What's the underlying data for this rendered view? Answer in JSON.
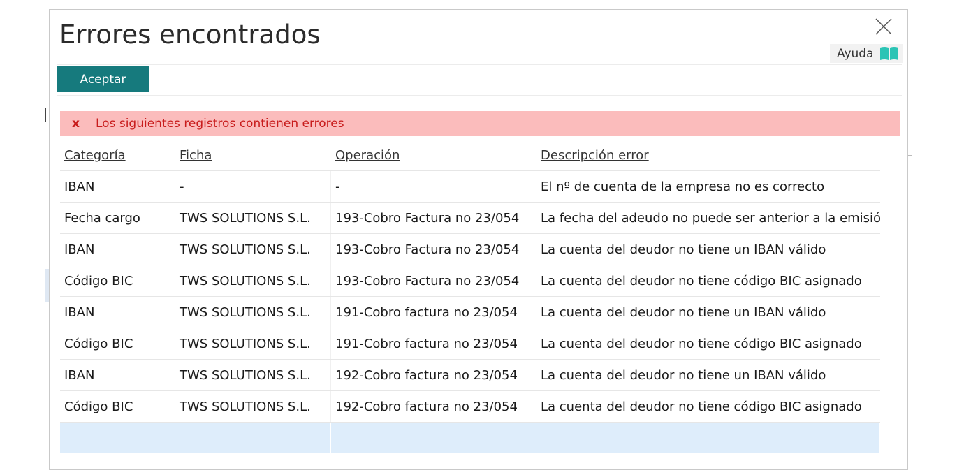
{
  "dialog": {
    "title": "Errores encontrados",
    "help_label": "Ayuda",
    "accept_label": "Aceptar",
    "close_icon": "close-icon",
    "help_icon": "book-icon",
    "accent_color": "#167a7d"
  },
  "banner": {
    "icon_text": "x",
    "message": "Los siguientes registros contienen errores",
    "background": "#fbbcbc",
    "text_color": "#c81c1c"
  },
  "table": {
    "headers": [
      "Categoría",
      "Ficha",
      "Operación",
      "Descripción error"
    ],
    "rows": [
      [
        "IBAN",
        "-",
        "-",
        "El nº de cuenta de la empresa no es correcto"
      ],
      [
        "Fecha cargo",
        "TWS SOLUTIONS S.L.",
        "193-Cobro Factura no 23/054",
        "La fecha del adeudo no puede ser anterior a la emisión de"
      ],
      [
        "IBAN",
        "TWS SOLUTIONS S.L.",
        "193-Cobro Factura no 23/054",
        "La cuenta del deudor no tiene un IBAN válido"
      ],
      [
        "Código BIC",
        "TWS SOLUTIONS S.L.",
        "193-Cobro Factura no 23/054",
        "La cuenta del deudor no tiene código BIC asignado"
      ],
      [
        "IBAN",
        "TWS SOLUTIONS S.L.",
        "191-Cobro factura no 23/054",
        "La cuenta del deudor no tiene un IBAN válido"
      ],
      [
        "Código BIC",
        "TWS SOLUTIONS S.L.",
        "191-Cobro factura no 23/054",
        "La cuenta del deudor no tiene código BIC asignado"
      ],
      [
        "IBAN",
        "TWS SOLUTIONS S.L.",
        "192-Cobro factura no 23/054",
        "La cuenta del deudor no tiene un IBAN válido"
      ],
      [
        "Código BIC",
        "TWS SOLUTIONS S.L.",
        "192-Cobro factura no 23/054",
        "La cuenta del deudor no tiene código BIC asignado"
      ]
    ]
  }
}
